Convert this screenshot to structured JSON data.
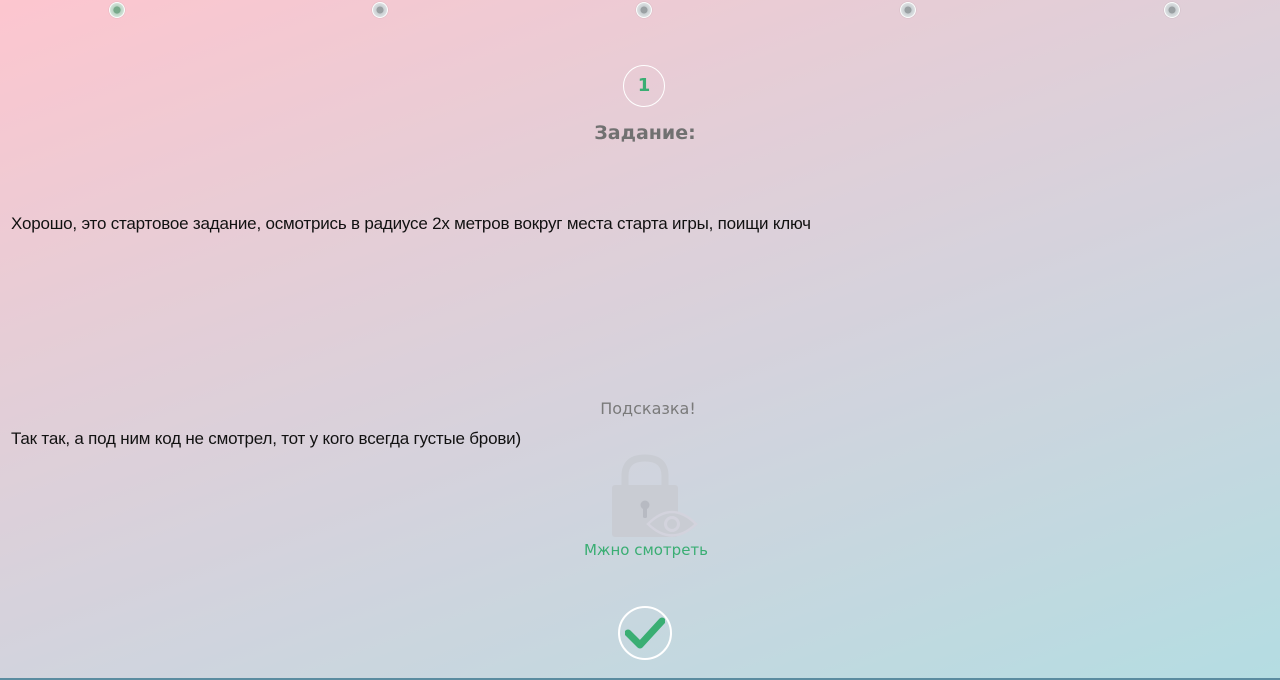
{
  "progress": {
    "steps": [
      "step-1",
      "step-2",
      "step-3",
      "step-4",
      "step-5"
    ],
    "active_index": 0
  },
  "task": {
    "number": "1",
    "title": "Задание:",
    "text": "Хорошо, это стартовое задание, осмотрись в радиусе 2х метров вокруг места старта игры, поищи ключ"
  },
  "hint": {
    "title": "Подсказка!",
    "text": "Так так, а под ним код не смотрел, тот у кого всегда густые брови)",
    "lock_caption": "Мжно смотреть"
  },
  "icons": {
    "lock": "lock-eye-icon",
    "confirm": "checkmark-icon"
  },
  "colors": {
    "accent": "#3aae73",
    "title": "#717171",
    "text": "#111111",
    "hint_title": "#7a7a7a",
    "lock": "#c9ccd3"
  }
}
